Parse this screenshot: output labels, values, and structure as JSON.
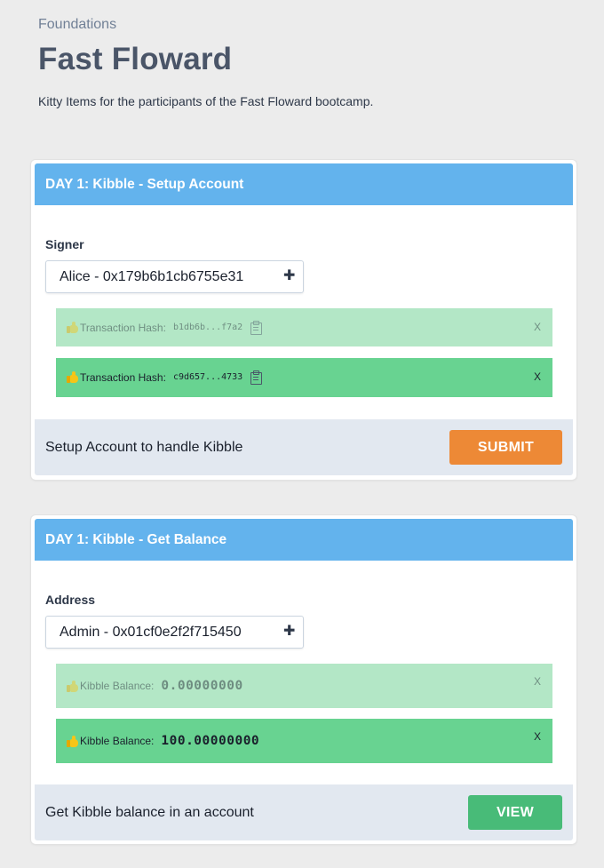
{
  "header": {
    "section": "Foundations",
    "title": "Fast Floward",
    "description": "Kitty Items for the participants of the Fast Floward bootcamp."
  },
  "cards": [
    {
      "title": "DAY 1: Kibble - Setup Account",
      "field_label": "Signer",
      "select_value": "Alice - 0x179b6b1cb6755e31",
      "results": [
        {
          "label": "Transaction Hash:",
          "value": "b1db6b...f7a2",
          "close": "X",
          "state": "faded"
        },
        {
          "label": "Transaction Hash:",
          "value": "c9d657...4733",
          "close": "X",
          "state": "active"
        }
      ],
      "footer_text": "Setup Account to handle Kibble",
      "button_label": "SUBMIT",
      "button_color": "#ed8936"
    },
    {
      "title": "DAY 1: Kibble - Get Balance",
      "field_label": "Address",
      "select_value": "Admin - 0x01cf0e2f2f715450",
      "results": [
        {
          "label": "Kibble Balance:",
          "value": "0.00000000",
          "close": "X",
          "state": "faded"
        },
        {
          "label": "Kibble Balance:",
          "value": "100.00000000",
          "close": "X",
          "state": "active"
        }
      ],
      "footer_text": "Get Kibble balance in an account",
      "button_label": "VIEW",
      "button_color": "#48bb78"
    }
  ],
  "colors": {
    "card_header": "#63b3ed",
    "result_faded": "#b3e7c6",
    "result_active": "#68d391",
    "footer": "#e2e8f0"
  },
  "icons": {
    "result_prefix": "thumbs-up-icon",
    "copy": "clipboard-icon",
    "select_toggle": "plus-icon"
  }
}
